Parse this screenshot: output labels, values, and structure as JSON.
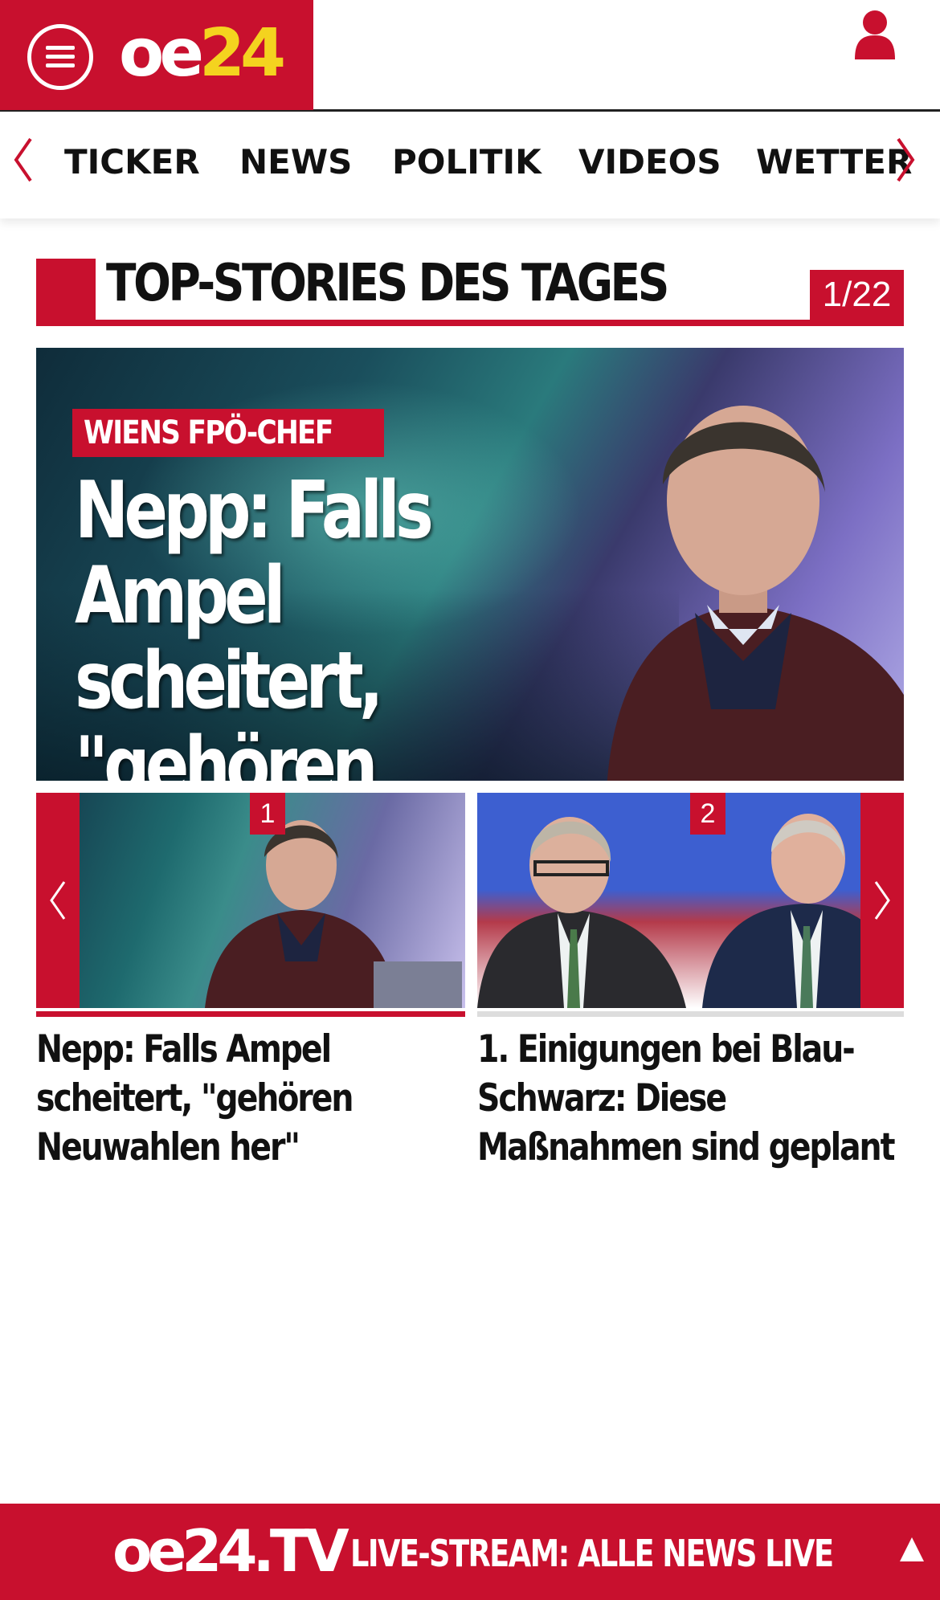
{
  "header": {
    "logo_oe": "oe",
    "logo_num": "24"
  },
  "nav": {
    "items": [
      "TICKER",
      "NEWS",
      "POLITIK",
      "VIDEOS",
      "WETTER"
    ]
  },
  "section": {
    "title": "TOP-STORIES DES TAGES",
    "counter": "1/22"
  },
  "hero": {
    "kicker": "WIENS FPÖ-CHEF",
    "headline": "Nepp: Falls Ampel scheitert, \"gehören Neuwahlen her\""
  },
  "thumbnails": [
    {
      "badge": "1",
      "title": "Nepp: Falls Ampel scheitert, \"gehören Neuwahlen her\"",
      "active": true
    },
    {
      "badge": "2",
      "title": "1. Einigungen bei Blau-Schwarz: Diese Maßnahmen sind geplant",
      "active": false
    }
  ],
  "live": {
    "logo": "oe24.TV",
    "text": "LIVE-STREAM:  ALLE NEWS LIVE"
  },
  "colors": {
    "brand_red": "#c8102e",
    "logo_yellow": "#f4d31f"
  }
}
